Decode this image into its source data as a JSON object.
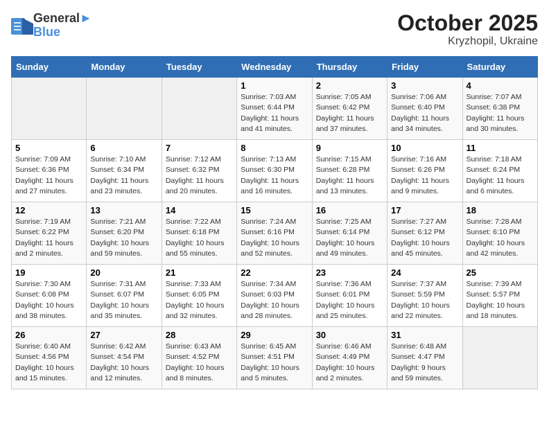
{
  "header": {
    "logo_general": "General",
    "logo_blue": "Blue",
    "title": "October 2025",
    "subtitle": "Kryzhopil, Ukraine"
  },
  "days_of_week": [
    "Sunday",
    "Monday",
    "Tuesday",
    "Wednesday",
    "Thursday",
    "Friday",
    "Saturday"
  ],
  "weeks": [
    [
      {
        "num": "",
        "info": "",
        "empty": true
      },
      {
        "num": "",
        "info": "",
        "empty": true
      },
      {
        "num": "",
        "info": "",
        "empty": true
      },
      {
        "num": "1",
        "info": "Sunrise: 7:03 AM\nSunset: 6:44 PM\nDaylight: 11 hours\nand 41 minutes."
      },
      {
        "num": "2",
        "info": "Sunrise: 7:05 AM\nSunset: 6:42 PM\nDaylight: 11 hours\nand 37 minutes."
      },
      {
        "num": "3",
        "info": "Sunrise: 7:06 AM\nSunset: 6:40 PM\nDaylight: 11 hours\nand 34 minutes."
      },
      {
        "num": "4",
        "info": "Sunrise: 7:07 AM\nSunset: 6:38 PM\nDaylight: 11 hours\nand 30 minutes."
      }
    ],
    [
      {
        "num": "5",
        "info": "Sunrise: 7:09 AM\nSunset: 6:36 PM\nDaylight: 11 hours\nand 27 minutes."
      },
      {
        "num": "6",
        "info": "Sunrise: 7:10 AM\nSunset: 6:34 PM\nDaylight: 11 hours\nand 23 minutes."
      },
      {
        "num": "7",
        "info": "Sunrise: 7:12 AM\nSunset: 6:32 PM\nDaylight: 11 hours\nand 20 minutes."
      },
      {
        "num": "8",
        "info": "Sunrise: 7:13 AM\nSunset: 6:30 PM\nDaylight: 11 hours\nand 16 minutes."
      },
      {
        "num": "9",
        "info": "Sunrise: 7:15 AM\nSunset: 6:28 PM\nDaylight: 11 hours\nand 13 minutes."
      },
      {
        "num": "10",
        "info": "Sunrise: 7:16 AM\nSunset: 6:26 PM\nDaylight: 11 hours\nand 9 minutes."
      },
      {
        "num": "11",
        "info": "Sunrise: 7:18 AM\nSunset: 6:24 PM\nDaylight: 11 hours\nand 6 minutes."
      }
    ],
    [
      {
        "num": "12",
        "info": "Sunrise: 7:19 AM\nSunset: 6:22 PM\nDaylight: 11 hours\nand 2 minutes."
      },
      {
        "num": "13",
        "info": "Sunrise: 7:21 AM\nSunset: 6:20 PM\nDaylight: 10 hours\nand 59 minutes."
      },
      {
        "num": "14",
        "info": "Sunrise: 7:22 AM\nSunset: 6:18 PM\nDaylight: 10 hours\nand 55 minutes."
      },
      {
        "num": "15",
        "info": "Sunrise: 7:24 AM\nSunset: 6:16 PM\nDaylight: 10 hours\nand 52 minutes."
      },
      {
        "num": "16",
        "info": "Sunrise: 7:25 AM\nSunset: 6:14 PM\nDaylight: 10 hours\nand 49 minutes."
      },
      {
        "num": "17",
        "info": "Sunrise: 7:27 AM\nSunset: 6:12 PM\nDaylight: 10 hours\nand 45 minutes."
      },
      {
        "num": "18",
        "info": "Sunrise: 7:28 AM\nSunset: 6:10 PM\nDaylight: 10 hours\nand 42 minutes."
      }
    ],
    [
      {
        "num": "19",
        "info": "Sunrise: 7:30 AM\nSunset: 6:08 PM\nDaylight: 10 hours\nand 38 minutes."
      },
      {
        "num": "20",
        "info": "Sunrise: 7:31 AM\nSunset: 6:07 PM\nDaylight: 10 hours\nand 35 minutes."
      },
      {
        "num": "21",
        "info": "Sunrise: 7:33 AM\nSunset: 6:05 PM\nDaylight: 10 hours\nand 32 minutes."
      },
      {
        "num": "22",
        "info": "Sunrise: 7:34 AM\nSunset: 6:03 PM\nDaylight: 10 hours\nand 28 minutes."
      },
      {
        "num": "23",
        "info": "Sunrise: 7:36 AM\nSunset: 6:01 PM\nDaylight: 10 hours\nand 25 minutes."
      },
      {
        "num": "24",
        "info": "Sunrise: 7:37 AM\nSunset: 5:59 PM\nDaylight: 10 hours\nand 22 minutes."
      },
      {
        "num": "25",
        "info": "Sunrise: 7:39 AM\nSunset: 5:57 PM\nDaylight: 10 hours\nand 18 minutes."
      }
    ],
    [
      {
        "num": "26",
        "info": "Sunrise: 6:40 AM\nSunset: 4:56 PM\nDaylight: 10 hours\nand 15 minutes."
      },
      {
        "num": "27",
        "info": "Sunrise: 6:42 AM\nSunset: 4:54 PM\nDaylight: 10 hours\nand 12 minutes."
      },
      {
        "num": "28",
        "info": "Sunrise: 6:43 AM\nSunset: 4:52 PM\nDaylight: 10 hours\nand 8 minutes."
      },
      {
        "num": "29",
        "info": "Sunrise: 6:45 AM\nSunset: 4:51 PM\nDaylight: 10 hours\nand 5 minutes."
      },
      {
        "num": "30",
        "info": "Sunrise: 6:46 AM\nSunset: 4:49 PM\nDaylight: 10 hours\nand 2 minutes."
      },
      {
        "num": "31",
        "info": "Sunrise: 6:48 AM\nSunset: 4:47 PM\nDaylight: 9 hours\nand 59 minutes."
      },
      {
        "num": "",
        "info": "",
        "empty": true
      }
    ]
  ]
}
